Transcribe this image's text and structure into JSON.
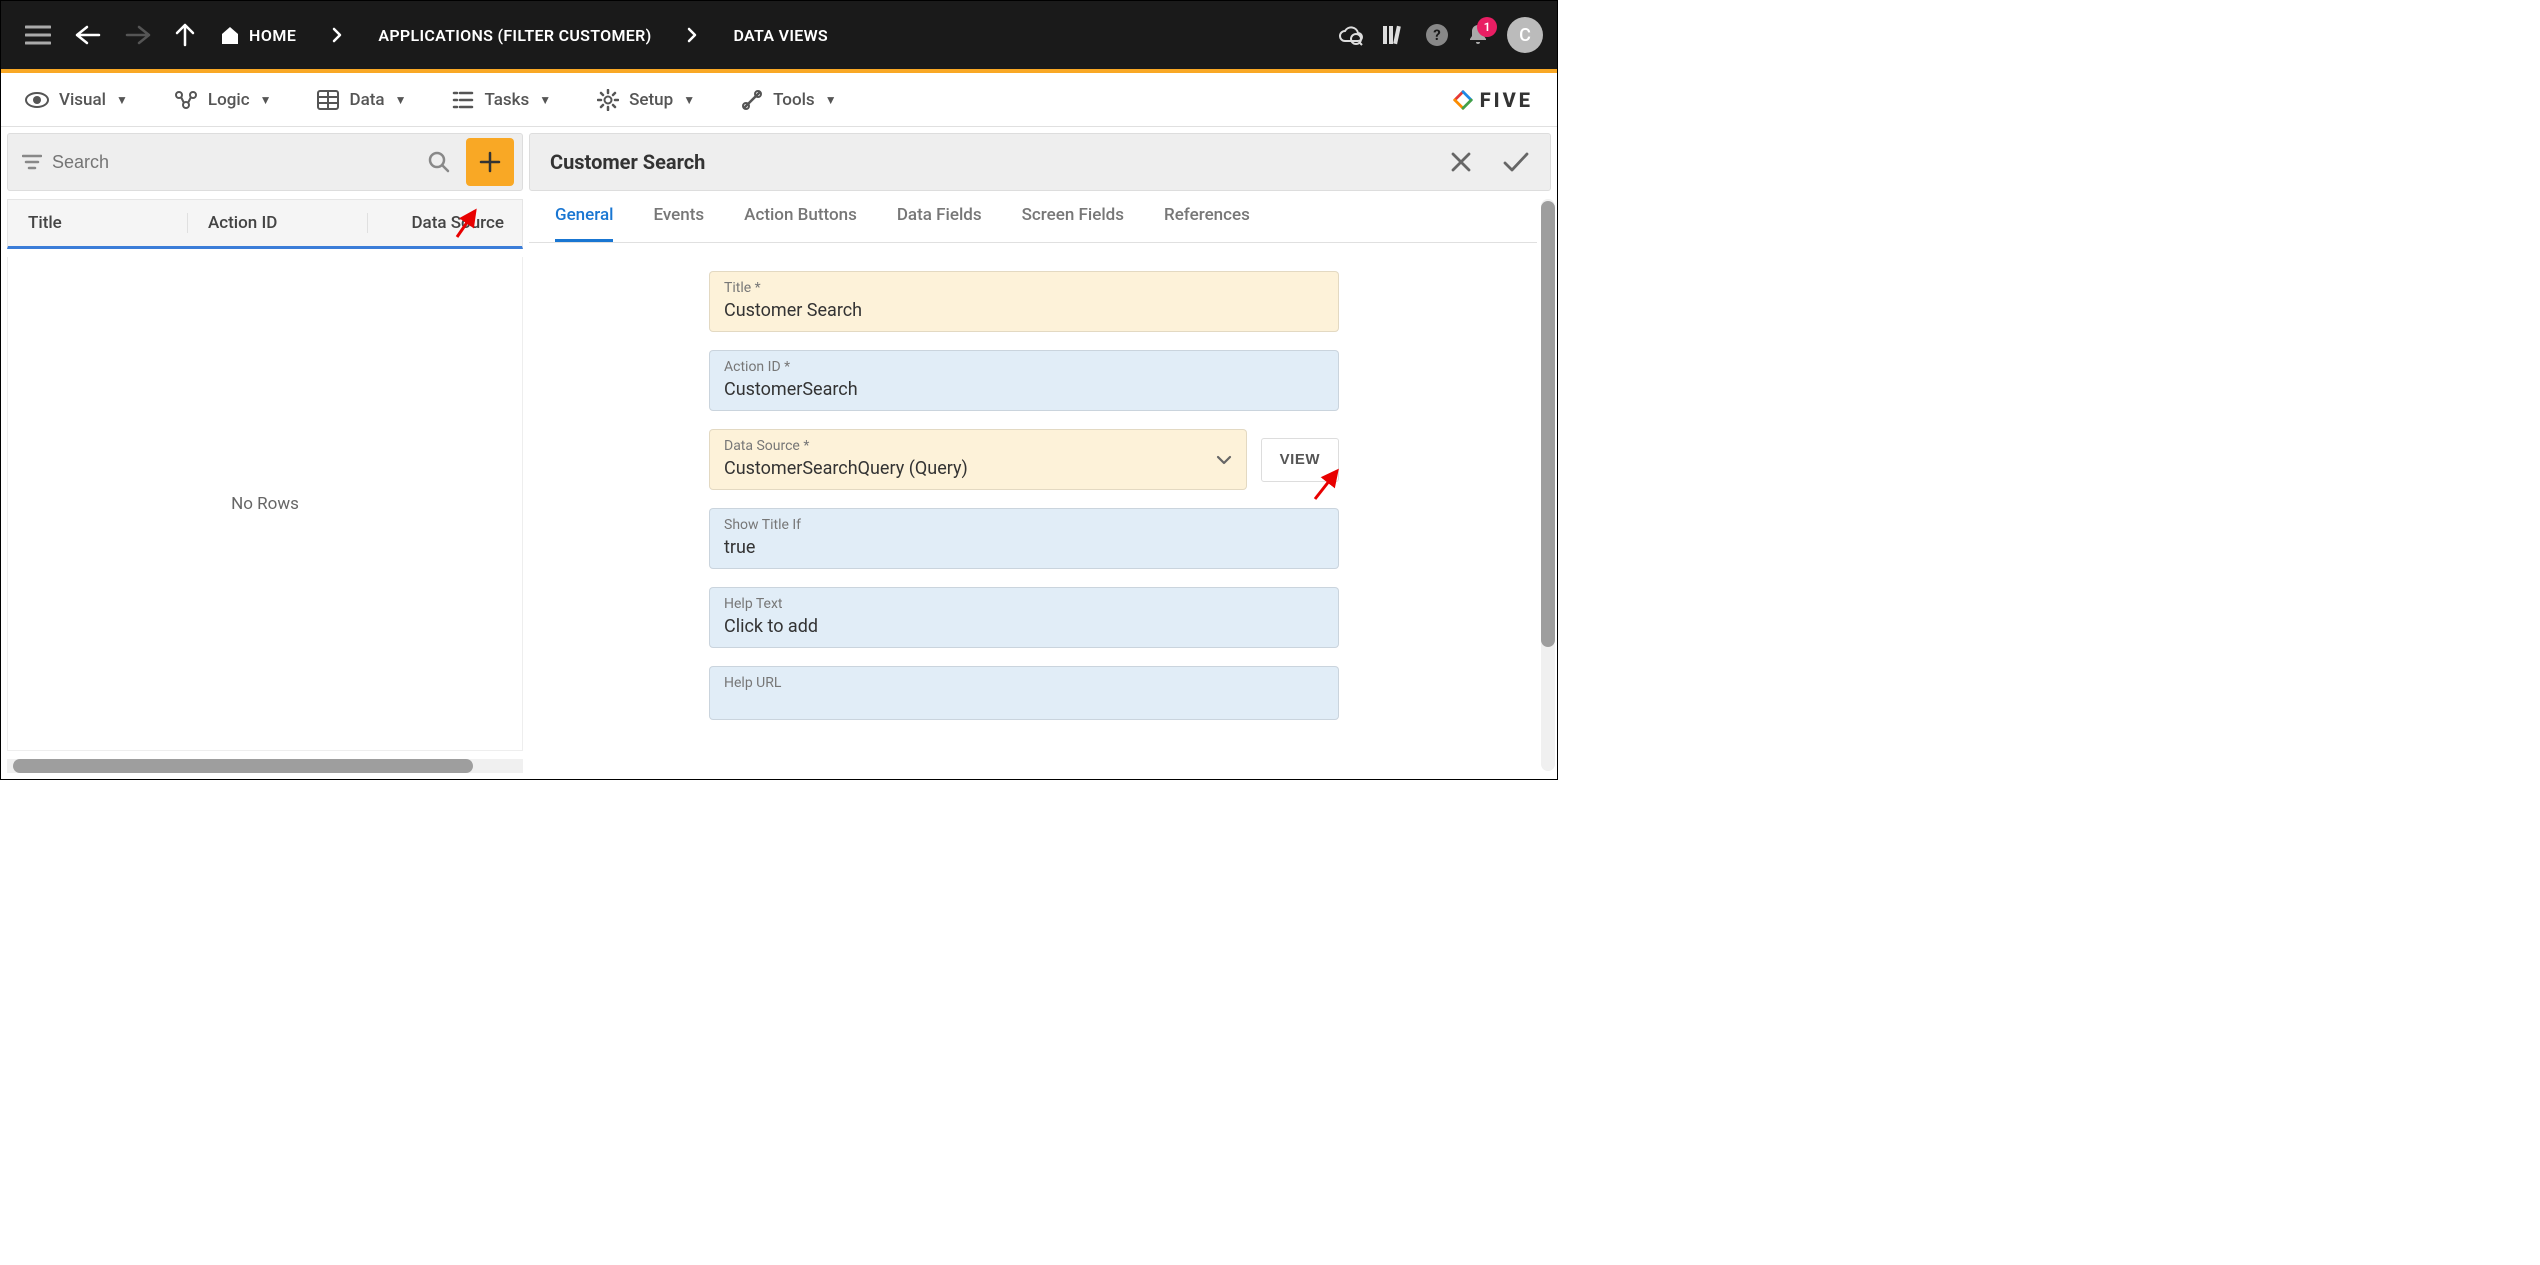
{
  "topbar": {
    "home": "HOME",
    "crumb_apps": "APPLICATIONS (FILTER CUSTOMER)",
    "crumb_dataviews": "DATA VIEWS",
    "notification_count": "1",
    "avatar_letter": "C"
  },
  "menubar": {
    "visual": "Visual",
    "logic": "Logic",
    "data": "Data",
    "tasks": "Tasks",
    "setup": "Setup",
    "tools": "Tools",
    "brand": "FIVE"
  },
  "left": {
    "search_placeholder": "Search",
    "col_title": "Title",
    "col_actionid": "Action ID",
    "col_datasource": "Data Source",
    "no_rows": "No Rows"
  },
  "right": {
    "title": "Customer Search",
    "tabs": {
      "general": "General",
      "events": "Events",
      "action_buttons": "Action Buttons",
      "data_fields": "Data Fields",
      "screen_fields": "Screen Fields",
      "references": "References"
    },
    "form": {
      "title_label": "Title *",
      "title_value": "Customer Search",
      "actionid_label": "Action ID *",
      "actionid_value": "CustomerSearch",
      "datasource_label": "Data Source *",
      "datasource_value": "CustomerSearchQuery (Query)",
      "view_btn": "VIEW",
      "showtitleif_label": "Show Title If",
      "showtitleif_value": "true",
      "helptext_label": "Help Text",
      "helptext_value": "Click to add",
      "helpurl_label": "Help URL",
      "helpurl_value": ""
    }
  }
}
